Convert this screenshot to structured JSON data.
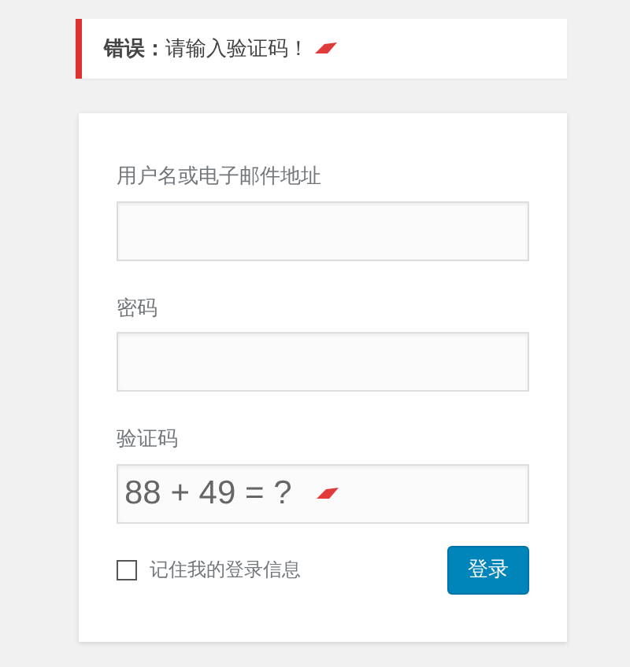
{
  "error_notice": {
    "message": "**错误：**请输入验证码！"
  },
  "login_form": {
    "fields": [
      {
        "label": "用户名或电子邮件地址",
        "kind": "text"
      },
      {
        "label": "密码",
        "kind": "password"
      },
      {
        "label": "验证码",
        "kind": "captcha",
        "placeholder": "88 + 49 = ?"
      }
    ],
    "remember": {
      "label": "记住我的登录信息",
      "checked": false
    },
    "submit": "登录"
  }
}
